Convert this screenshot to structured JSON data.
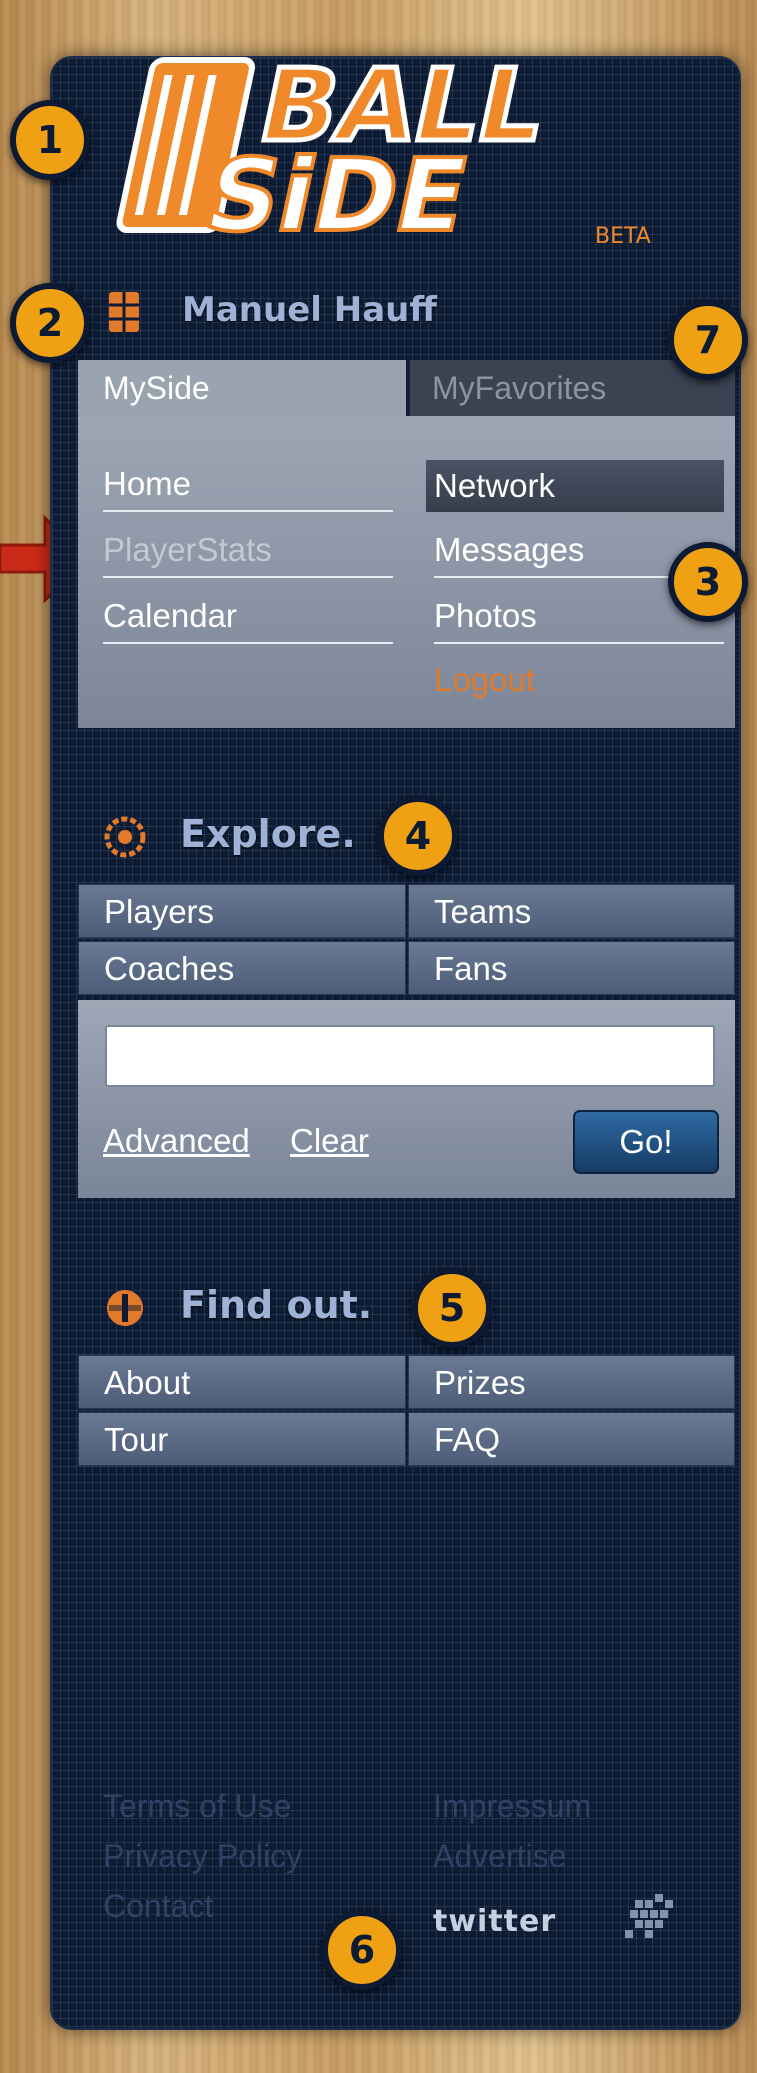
{
  "brand": {
    "line1": "BALL",
    "line2": "SiDE",
    "tag": "BETA"
  },
  "user": {
    "name": "Manuel Hauff"
  },
  "tabs": [
    {
      "label": "MySide",
      "active": true
    },
    {
      "label": "MyFavorites",
      "active": false
    }
  ],
  "menu": {
    "left": [
      "Home",
      "PlayerStats",
      "Calendar"
    ],
    "right": [
      "Network",
      "Messages",
      "Photos",
      "Logout"
    ]
  },
  "explore": {
    "title": "Explore.",
    "grid": [
      "Players",
      "Teams",
      "Coaches",
      "Fans"
    ],
    "search": {
      "value": "",
      "placeholder": ""
    },
    "links": {
      "advanced": "Advanced",
      "clear": "Clear"
    },
    "go_label": "Go!"
  },
  "findout": {
    "title": "Find out.",
    "grid": [
      "About",
      "Prizes",
      "Tour",
      "FAQ"
    ]
  },
  "footer": {
    "left": [
      "Terms of Use",
      "Privacy Policy",
      "Contact"
    ],
    "right": [
      "Impressum",
      "Advertise"
    ],
    "twitter": "twitter"
  },
  "badges": [
    "1",
    "2",
    "3",
    "4",
    "5",
    "6",
    "7"
  ],
  "colors": {
    "accent": "#efa113",
    "panel": "#0d1b33",
    "logout": "#e37a2b",
    "logo_orange": "#f0892a"
  }
}
